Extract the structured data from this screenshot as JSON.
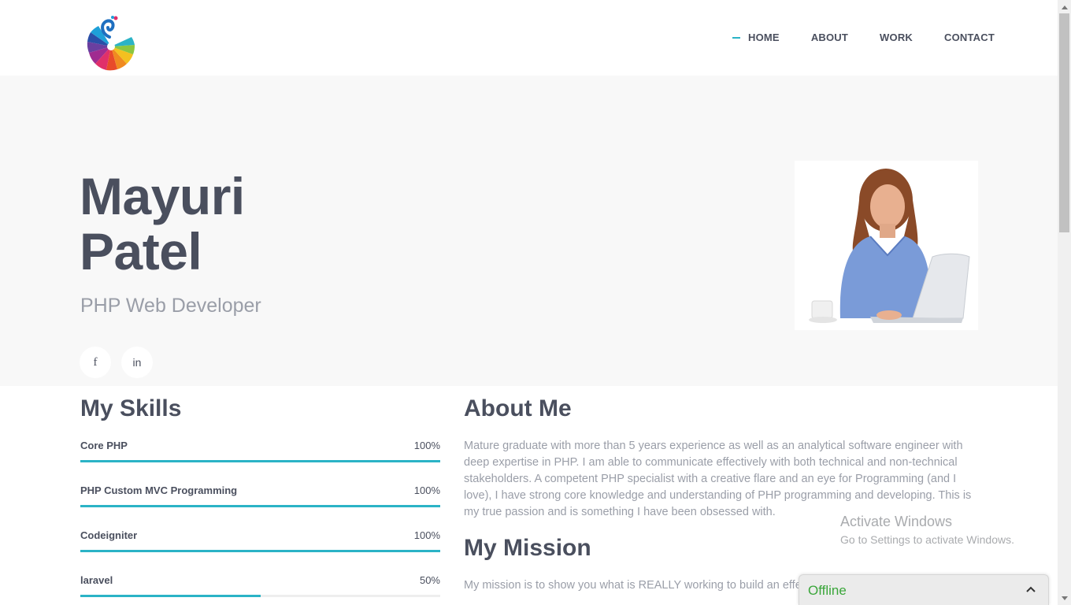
{
  "nav": {
    "items": [
      {
        "label": "HOME",
        "active": true
      },
      {
        "label": "ABOUT",
        "active": false
      },
      {
        "label": "WORK",
        "active": false
      },
      {
        "label": "CONTACT",
        "active": false
      }
    ]
  },
  "hero": {
    "name_line1": "Mayuri",
    "name_line2": "Patel",
    "role": "PHP Web Developer",
    "social": {
      "facebook": "f",
      "linkedin": "in"
    }
  },
  "skills": {
    "title": "My Skills",
    "items": [
      {
        "name": "Core PHP",
        "percent_label": "100%",
        "level": 1.0
      },
      {
        "name": "PHP Custom MVC Programming",
        "percent_label": "100%",
        "level": 1.0
      },
      {
        "name": "Codeigniter",
        "percent_label": "100%",
        "level": 1.0
      },
      {
        "name": "laravel",
        "percent_label": "50%",
        "level": 0.5
      }
    ]
  },
  "about": {
    "title": "About Me",
    "text": "Mature graduate with more than 5 years experience as well as an analytical software engineer with deep expertise in PHP. I am able to communicate effectively with both technical and non-technical stakeholders. A competent PHP specialist with a creative flare and an eye for Programming (and I love), I have strong core knowledge and understanding of PHP programming and developing. This is my true passion and is something I have been obsessed with."
  },
  "mission": {
    "title": "My Mission",
    "text": "My mission is to show you what is REALLY working to build an effe your business."
  },
  "windows": {
    "title": "Activate Windows",
    "subtitle": "Go to Settings to activate Windows."
  },
  "chat": {
    "status": "Offline"
  },
  "colors": {
    "accent": "#2bb3c6",
    "heading": "#4a4f5e",
    "muted": "#9a9ea8",
    "hero_bg": "#f8f8f8",
    "offline": "#3aa63a"
  }
}
